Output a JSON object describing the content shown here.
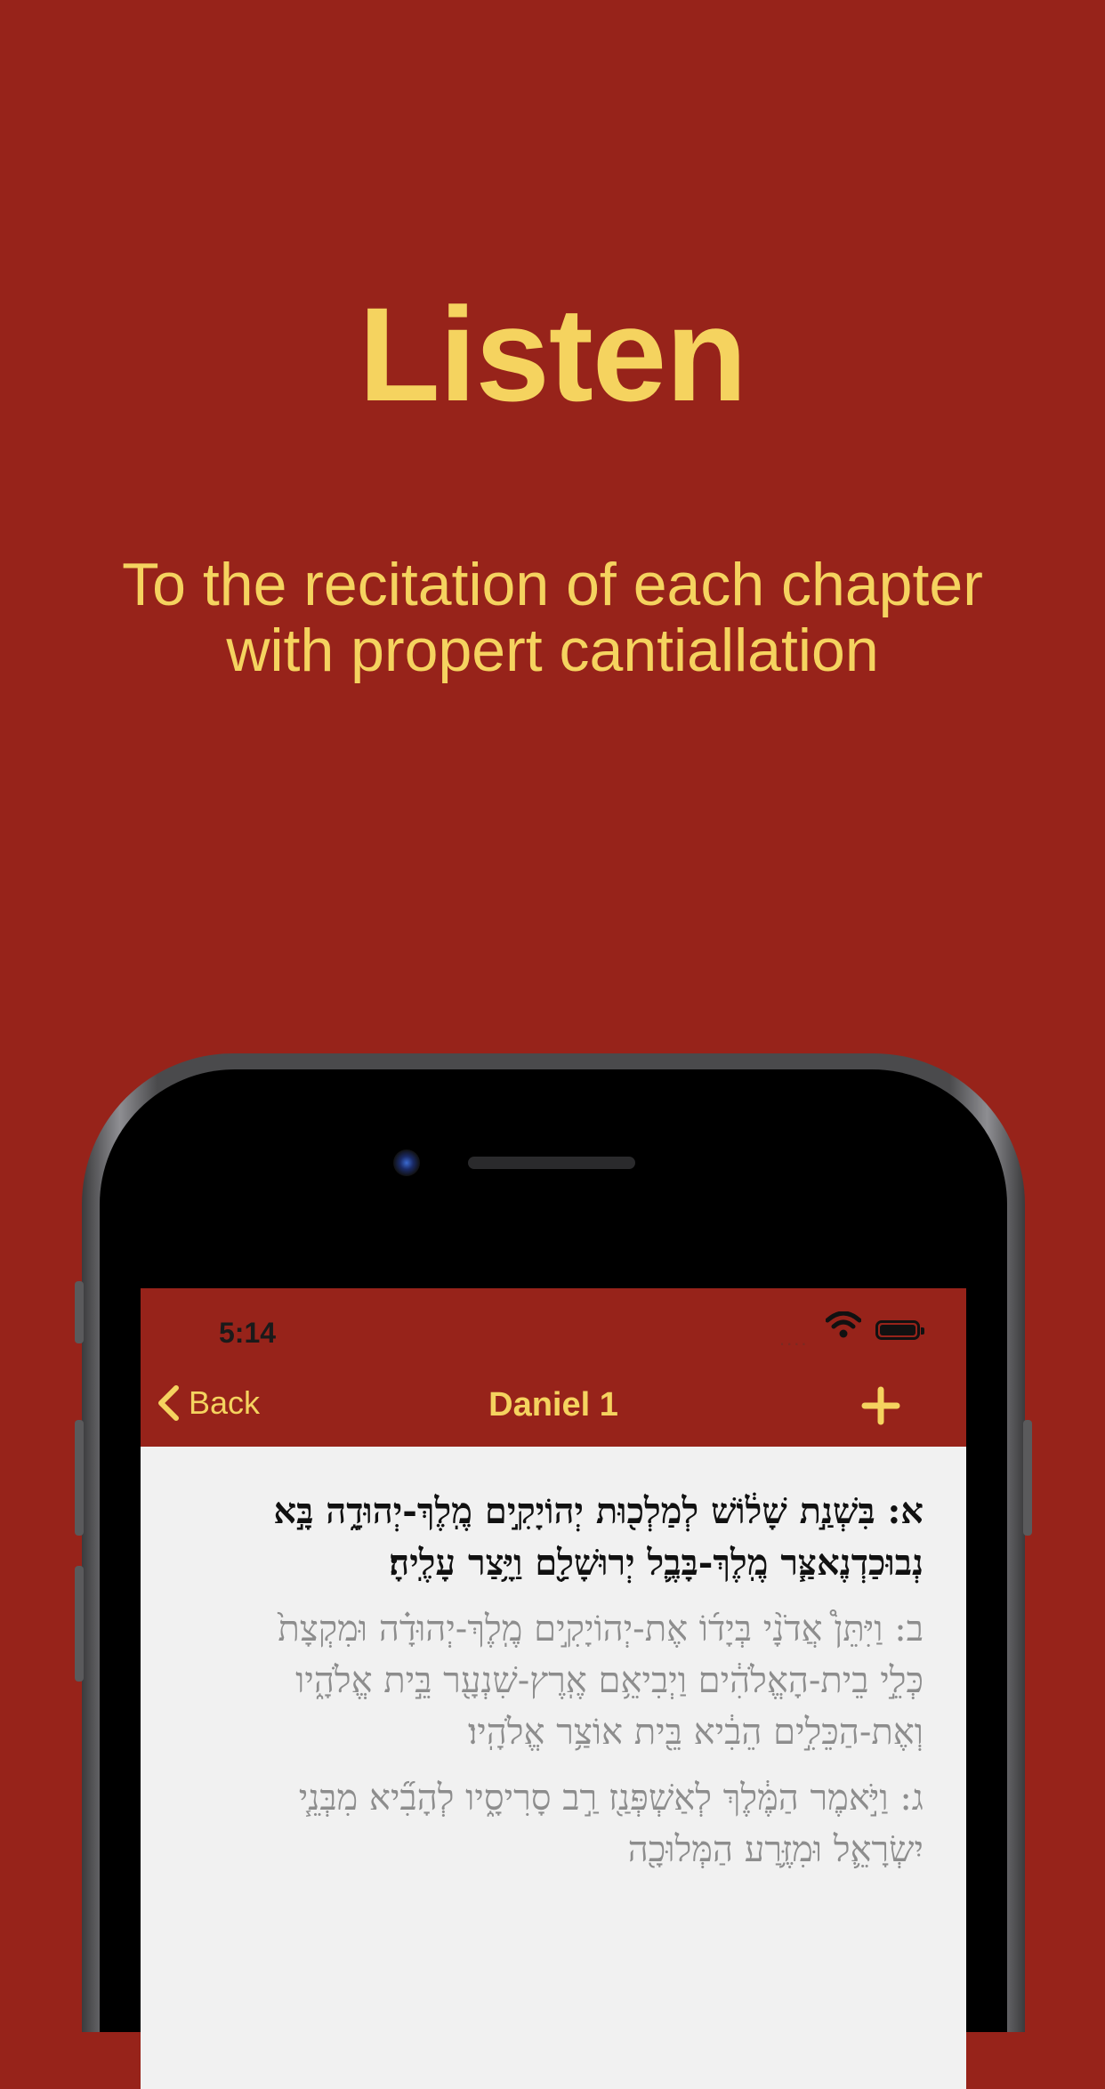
{
  "promo": {
    "headline": "Listen",
    "subtitle_line1": "To the recitation of each chapter",
    "subtitle_line2": "with propert cantiallation"
  },
  "status_bar": {
    "time": "5:14",
    "signal": "....",
    "wifi_icon": "wifi-icon",
    "battery_icon": "battery-icon"
  },
  "nav": {
    "back_label": "Back",
    "title": "Daniel 1",
    "add_icon": "plus-icon"
  },
  "verses": [
    {
      "text": "א: בִּשְׁנַ֣ת שָׁל֔וֹשׁ לְמַלְכ֖וּת יְהוֹיָקִ֣ים מֶֽלֶךְ-יְהוּדָ֑ה בָּ֣א נְבוּכַדְנֶאצַּ֧ר מֶֽלֶךְ-בָּבֶ֛ל יְרוּשָׁלִַ֖ם וַיָּ֥צַר עָלֶֽיהָ׃",
      "state": "active"
    },
    {
      "text": "ב: וַיִּתֵּן֩ אֲדֹנָ֨י בְּיָד֜וֹ אֶת-יְהוֹיָקִ֣ים מֶֽלֶךְ-יְהוּדָ֗ה וּמִקְצָת֙ כְּלֵ֣י בֵית-הָאֱלֹהִ֔ים וַיְבִיאֵ֥ם אֶֽרֶץ-שִׁנְעָ֖ר בֵּ֣ית אֱלֹהָ֑יו וְאֶת-הַכֵּלִ֣ים הֵבִ֔יא בֵּ֖ית אוֹצַ֥ר אֱלֹהָֽיו׃",
      "state": "dim"
    },
    {
      "text": "ג: וַיֹּ֣אמֶר הַמֶּ֔לֶךְ לְאַשְׁפְּנַ֖ז רַ֣ב סָרִיסָ֑יו לְהָבִ֞יא מִבְּנֵ֧י יִשְׂרָאֵ֛ל וּמִזֶּ֥רַע הַמְּלוּכָ֖ה",
      "state": "dim"
    }
  ]
}
